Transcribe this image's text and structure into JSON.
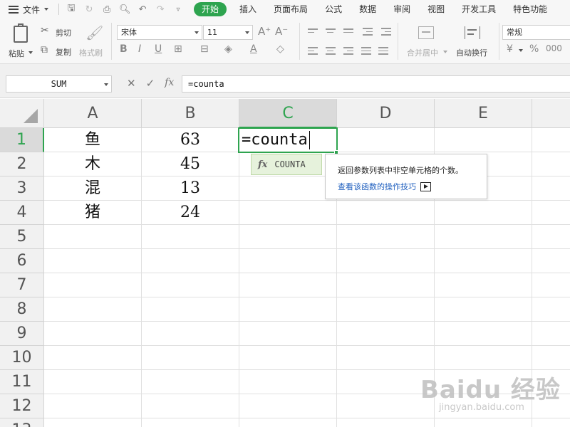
{
  "menubar": {
    "file_label": "文件",
    "tabs": [
      "开始",
      "插入",
      "页面布局",
      "公式",
      "数据",
      "审阅",
      "视图",
      "开发工具",
      "特色功能"
    ],
    "active_tab": "开始"
  },
  "ribbon": {
    "paste_label": "粘贴",
    "cut_label": "剪切",
    "copy_label": "复制",
    "format_painter_label": "格式刷",
    "font_name": "宋体",
    "font_size": "11",
    "merge_center_label": "合并居中",
    "wrap_text_label": "自动换行",
    "number_format": "常规"
  },
  "formula_bar": {
    "name_box": "SUM",
    "formula": "=counta"
  },
  "columns": [
    "A",
    "B",
    "C",
    "D",
    "E"
  ],
  "rows": [
    "1",
    "2",
    "3",
    "4",
    "5",
    "6",
    "7",
    "8",
    "9",
    "10",
    "11",
    "12",
    "13"
  ],
  "cells": {
    "A1": "鱼",
    "B1": "63",
    "A2": "木",
    "B2": "45",
    "A3": "混",
    "B3": "13",
    "A4": "猪",
    "B4": "24"
  },
  "active_cell": {
    "ref": "C1",
    "text": "=counta"
  },
  "autocomplete": {
    "function_name": "COUNTA",
    "description": "返回参数列表中非空单元格的个数。",
    "help_link": "查看该函数的操作技巧"
  },
  "watermark": {
    "brand": "Baidu 经验",
    "url": "jingyan.baidu.com"
  },
  "colors": {
    "accent": "#2ea44f",
    "link": "#1f5fbf"
  }
}
